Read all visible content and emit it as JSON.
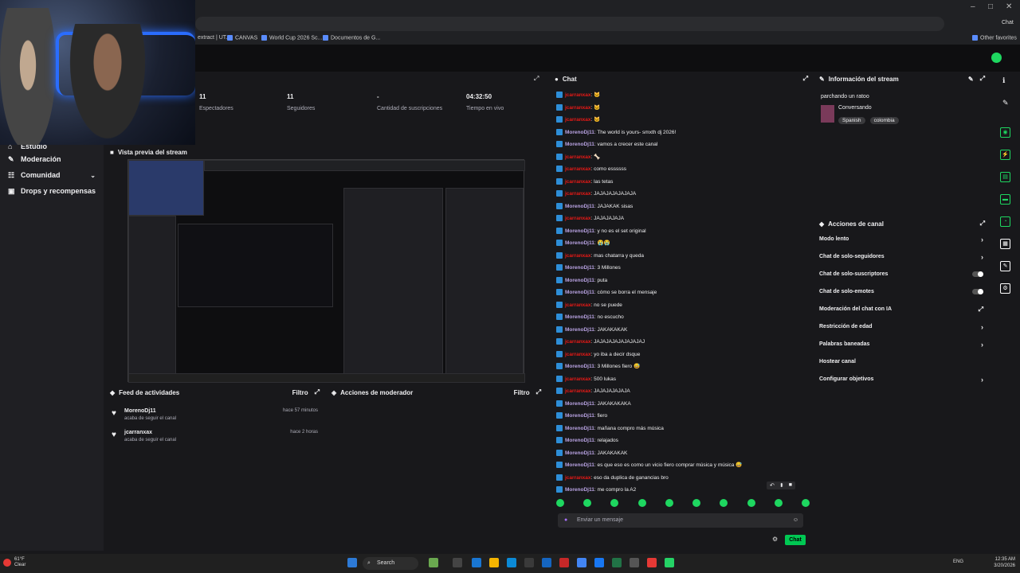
{
  "browser": {
    "window_controls": [
      "–",
      "□",
      "✕"
    ],
    "profile_label": "Chat",
    "bookmarks": [
      {
        "label": "extract | UT..."
      },
      {
        "label": "CANVAS"
      },
      {
        "label": "World Cup 2026 Sc..."
      },
      {
        "label": "Documentos de G..."
      }
    ],
    "other_favorites": "Other favorites"
  },
  "nav": {
    "items": [
      {
        "label": "Estudio",
        "icon": "home-icon"
      },
      {
        "label": "Moderación",
        "icon": "wrench-icon"
      },
      {
        "label": "Comunidad",
        "icon": "community-icon",
        "chevron": "⌄"
      },
      {
        "label": "Drops y recompensas",
        "icon": "gift-icon"
      }
    ]
  },
  "stats": [
    {
      "value": "11",
      "label": "Espectadores"
    },
    {
      "value": "11",
      "label": "Seguidores"
    },
    {
      "value": "-",
      "label": "Cantidad de suscripciones"
    },
    {
      "value": "04:32:50",
      "label": "Tiempo en vivo"
    }
  ],
  "preview": {
    "title": "Vista previa del stream"
  },
  "feed": {
    "title": "Feed de actividades",
    "filter": "Filtro",
    "items": [
      {
        "name": "MorenoDj11",
        "action": "acaba de seguir el canal",
        "time": "hace 57 minutos"
      },
      {
        "name": "jcarranxax",
        "action": "acaba de seguir el canal",
        "time": "hace 2 horas"
      }
    ]
  },
  "mod_actions": {
    "title": "Acciones de moderador",
    "filter": "Filtro"
  },
  "chat": {
    "title": "Chat",
    "placeholder": "Enviar un mensaje",
    "send_label": "Chat",
    "messages": [
      {
        "user": "jcarranxax",
        "type": "u2",
        "text": ": 🐱"
      },
      {
        "user": "jcarranxax",
        "type": "u2",
        "text": ": 🐱"
      },
      {
        "user": "jcarranxax",
        "type": "u2",
        "text": ": 🐱"
      },
      {
        "user": "MorenoDj11",
        "type": "u1",
        "text": ": The world is yours- smxth dj 2026!"
      },
      {
        "user": "MorenoDj11",
        "type": "u1",
        "text": ": vamos a crecer este canal"
      },
      {
        "user": "jcarranxax",
        "type": "u2",
        "text": ": 🦴"
      },
      {
        "user": "jcarranxax",
        "type": "u2",
        "text": ": como essssss"
      },
      {
        "user": "jcarranxax",
        "type": "u2",
        "text": ": las tetas"
      },
      {
        "user": "jcarranxax",
        "type": "u2",
        "text": ": JAJAJAJAJAJAJA"
      },
      {
        "user": "MorenoDj11",
        "type": "u1",
        "text": ": JAJAKAK sisas"
      },
      {
        "user": "jcarranxax",
        "type": "u2",
        "text": ": JAJAJAJAJA"
      },
      {
        "user": "MorenoDj11",
        "type": "u1",
        "text": ": y no es el set original"
      },
      {
        "user": "MorenoDj11",
        "type": "u1",
        "text": ": 😭😭"
      },
      {
        "user": "jcarranxax",
        "type": "u2",
        "text": ": mas chatarra y queda"
      },
      {
        "user": "MorenoDj11",
        "type": "u1",
        "text": ": 3 Millones"
      },
      {
        "user": "MorenoDj11",
        "type": "u1",
        "text": ": puta"
      },
      {
        "user": "MorenoDj11",
        "type": "u1",
        "text": ": cómo se borra el mensaje"
      },
      {
        "user": "jcarranxax",
        "type": "u2",
        "text": ": no se puede"
      },
      {
        "user": "MorenoDj11",
        "type": "u1",
        "text": ": no escucho"
      },
      {
        "user": "MorenoDj11",
        "type": "u1",
        "text": ": JAKAKAKAK"
      },
      {
        "user": "jcarranxax",
        "type": "u2",
        "text": ": JAJAJAJAJAJAJAJAJ"
      },
      {
        "user": "jcarranxax",
        "type": "u2",
        "text": ": yo iba a decir dsque"
      },
      {
        "user": "MorenoDj11",
        "type": "u1",
        "text": ": 3 Millones fiero 😅"
      },
      {
        "user": "jcarranxax",
        "type": "u2",
        "text": ": 500 lukas"
      },
      {
        "user": "jcarranxax",
        "type": "u2",
        "text": ": JAJAJAJAJAJA"
      },
      {
        "user": "MorenoDj11",
        "type": "u1",
        "text": ": JAKAKAKAKA"
      },
      {
        "user": "MorenoDj11",
        "type": "u1",
        "text": ": fiero"
      },
      {
        "user": "MorenoDj11",
        "type": "u1",
        "text": ": mañana compro más música"
      },
      {
        "user": "MorenoDj11",
        "type": "u1",
        "text": ": relajados"
      },
      {
        "user": "MorenoDj11",
        "type": "u1",
        "text": ": JAKAKAKAK"
      },
      {
        "user": "MorenoDj11",
        "type": "u1",
        "text": ": es que eso es como un vicio fiero comprar música y música 😅"
      },
      {
        "user": "jcarranxax",
        "type": "u2",
        "text": ": eso da duplica de ganancias bro"
      },
      {
        "user": "MorenoDj11",
        "type": "u1",
        "text": ": me compro la A2"
      }
    ]
  },
  "info": {
    "title": "Información del stream",
    "stream_title": "parchando un ratoo",
    "category": "Conversando",
    "tags": [
      "Spanish",
      "colombia"
    ]
  },
  "channel_actions": {
    "title": "Acciones de canal",
    "items": [
      {
        "label": "Modo lento",
        "control": "arrow"
      },
      {
        "label": "Chat de solo-seguidores",
        "control": "arrow"
      },
      {
        "label": "Chat de solo-suscriptores",
        "control": "toggle"
      },
      {
        "label": "Chat de solo-emotes",
        "control": "toggle"
      },
      {
        "label": "Moderación del chat con IA",
        "control": "ext"
      },
      {
        "label": "Restricción de edad",
        "control": "arrow"
      },
      {
        "label": "Palabras baneadas",
        "control": "arrow"
      },
      {
        "label": "Hostear canal",
        "control": "none"
      },
      {
        "label": "Configurar objetivos",
        "control": "arrow"
      }
    ]
  },
  "taskbar": {
    "weather_temp": "61°F",
    "weather_desc": "Clear",
    "search": "Search",
    "lang": "ENG",
    "time": "12:35 AM",
    "date": "3/20/2026"
  },
  "colors": {
    "accent_green": "#1ed760",
    "user_purple": "#b9a3e3",
    "user_red": "#e91916",
    "bg": "#18181b"
  }
}
